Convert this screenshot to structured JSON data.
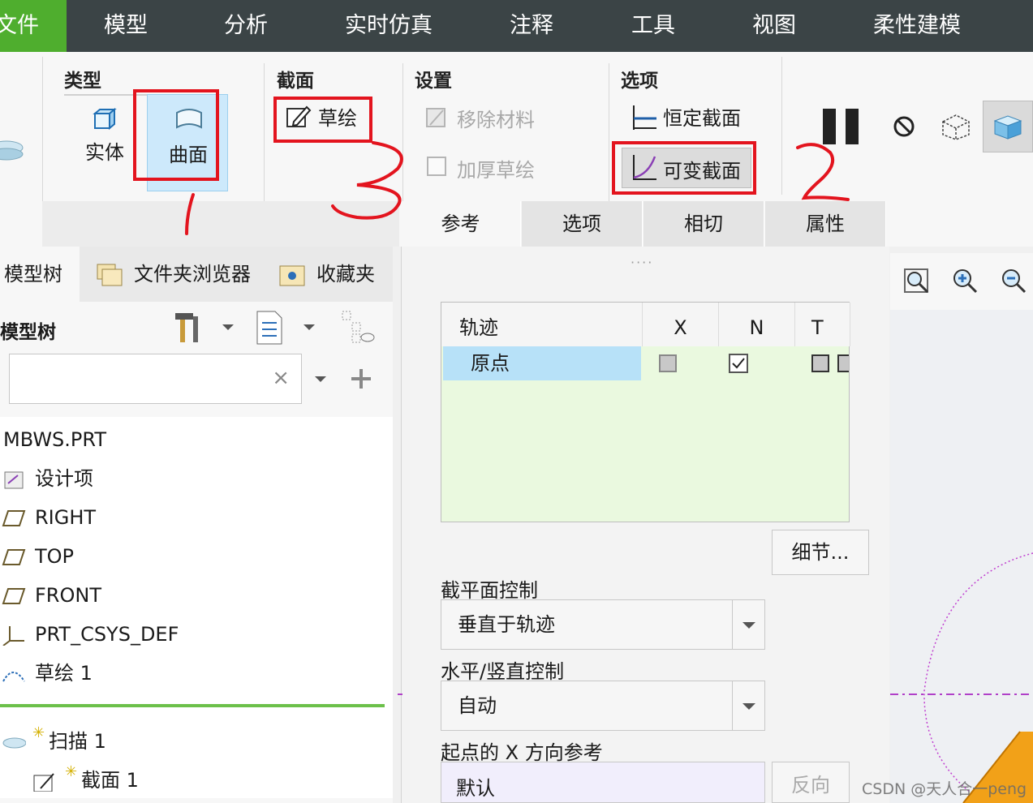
{
  "menu": {
    "file": "文件",
    "items": [
      "模型",
      "分析",
      "实时仿真",
      "注释",
      "工具",
      "视图",
      "柔性建模"
    ]
  },
  "ribbon": {
    "type_group": {
      "title": "类型",
      "solid": "实体",
      "surface": "曲面"
    },
    "section_group": {
      "title": "截面",
      "sketch": "草绘"
    },
    "settings_group": {
      "title": "设置",
      "remove_material": "移除材料",
      "thicken_sketch": "加厚草绘"
    },
    "options_group": {
      "title": "选项",
      "constant_section": "恒定截面",
      "variable_section": "可变截面"
    }
  },
  "dashboard_tabs": [
    "参考",
    "选项",
    "相切",
    "属性"
  ],
  "navigator": {
    "tabs": [
      "模型树",
      "文件夹浏览器",
      "收藏夹"
    ],
    "tree_title": "模型树",
    "search": {
      "value": "",
      "clear": "×"
    },
    "items": [
      {
        "label": "MBWS.PRT",
        "icon": "part-icon"
      },
      {
        "label": "设计项",
        "icon": "design-items-icon"
      },
      {
        "label": "RIGHT",
        "icon": "datum-plane-icon"
      },
      {
        "label": "TOP",
        "icon": "datum-plane-icon"
      },
      {
        "label": "FRONT",
        "icon": "datum-plane-icon"
      },
      {
        "label": "PRT_CSYS_DEF",
        "icon": "coordinate-system-icon"
      },
      {
        "label": "草绘 1",
        "icon": "sketch-icon"
      },
      {
        "label": "扫描 1",
        "icon": "sweep-icon"
      },
      {
        "label": "截面 1",
        "icon": "section-sketch-icon"
      }
    ]
  },
  "references": {
    "headers": [
      "轨迹",
      "X",
      "N",
      "T"
    ],
    "rows": [
      {
        "trajectory": "原点",
        "x": false,
        "n": true,
        "t": false
      }
    ],
    "details_button": "细节..."
  },
  "section_plane_control": {
    "label": "截平面控制",
    "value": "垂直于轨迹"
  },
  "hv_control": {
    "label": "水平/竖直控制",
    "value": "自动"
  },
  "x_reference": {
    "label": "起点的 X 方向参考",
    "value": "默认",
    "flip_button": "反向"
  },
  "annotations": {
    "mark1": "1",
    "mark2": "2",
    "mark3": "3"
  },
  "watermark": "CSDN @天人合一peng",
  "colors": {
    "menubar": "#3b4446",
    "file_tab": "#4fae2e",
    "selected_row": "#b7e1f8",
    "table_bg": "#eaf9df",
    "highlight_box": "#e3141e",
    "separator_green": "#6cc04a"
  }
}
